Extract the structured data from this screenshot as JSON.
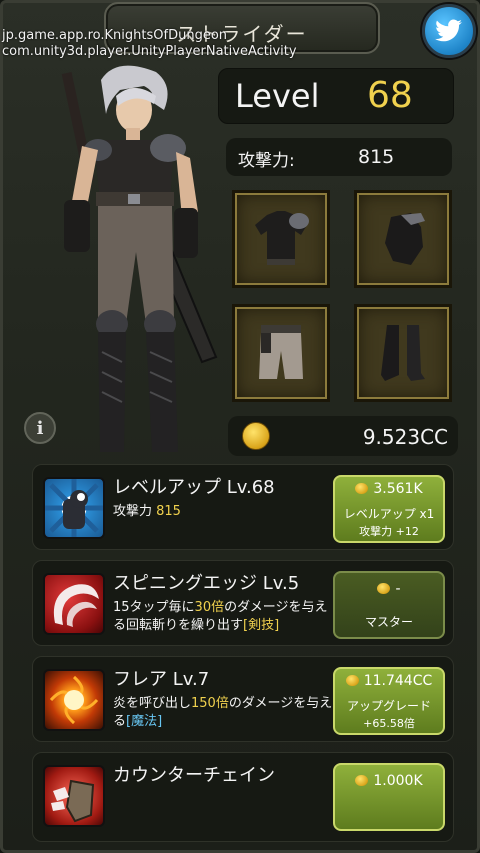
{
  "header": {
    "title": "ストライダー"
  },
  "debug": {
    "line1": "jp.game.app.ro.KnightsOfDungeon",
    "line2": "com.unity3d.player.UnityPlayerNativeActivity"
  },
  "stats": {
    "level_label": "Level",
    "level_value": "68",
    "attack_label": "攻撃力:",
    "attack_value": "815",
    "currency": "9.523CC"
  },
  "equipment": [
    {
      "icon": "shirt-icon"
    },
    {
      "icon": "glove-icon"
    },
    {
      "icon": "pants-icon"
    },
    {
      "icon": "boots-icon"
    }
  ],
  "skills": [
    {
      "title": "レベルアップ Lv.68",
      "desc_prefix": "攻撃力 ",
      "desc_highlight": "815",
      "button": {
        "cost": "3.561K",
        "line1": "レベルアップ x1",
        "line2": "攻撃力 +12"
      }
    },
    {
      "title": "スピニングエッジ Lv.5",
      "desc_a": "15タップ毎に",
      "desc_b": "30倍",
      "desc_c": "のダメージを与える回転斬りを繰り出す",
      "desc_tag": "[剣技]",
      "button": {
        "cost": "-",
        "line1": "マスター"
      }
    },
    {
      "title": "フレア Lv.7",
      "desc_a": "炎を呼び出し",
      "desc_b": "150倍",
      "desc_c": "のダメージを与える",
      "desc_tag": "[魔法]",
      "button": {
        "cost": "11.744CC",
        "line1": "アップグレード",
        "line2": "+65.58倍"
      }
    },
    {
      "title": "カウンターチェイン",
      "button": {
        "cost": "1.000K"
      }
    }
  ],
  "colors": {
    "accent_yellow": "#f0d14e",
    "accent_blue": "#68c6f2",
    "button_green": "#8fb03b"
  }
}
